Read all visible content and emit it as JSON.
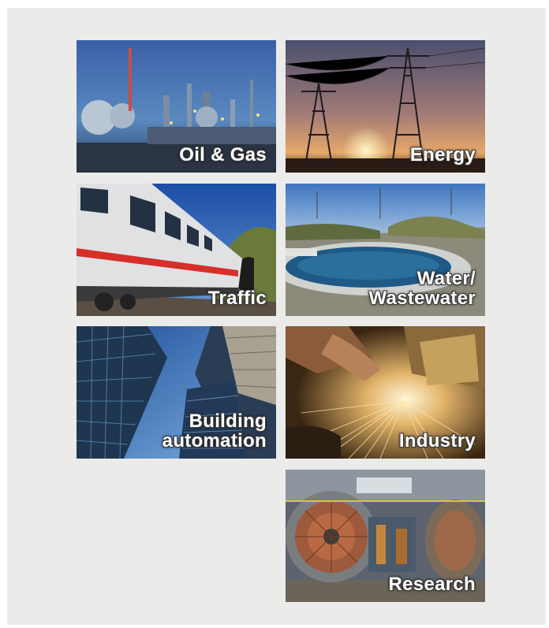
{
  "tiles": {
    "oil_gas": {
      "line1": "Oil & Gas"
    },
    "energy": {
      "line1": "Energy"
    },
    "traffic": {
      "line1": "Traffic"
    },
    "water": {
      "line1": "Water/",
      "line2": "Wastewater"
    },
    "building": {
      "line1": "Building",
      "line2": "automation"
    },
    "industry": {
      "line1": "Industry"
    },
    "research": {
      "line1": "Research"
    }
  },
  "colors": {
    "panel_bg": "#ebebea",
    "label_text": "#ffffff"
  }
}
